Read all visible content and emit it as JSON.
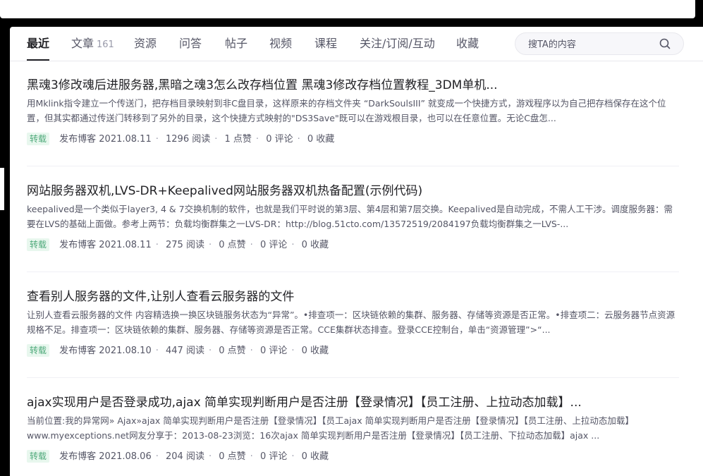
{
  "tabs": [
    {
      "label": "最近",
      "count": ""
    },
    {
      "label": "文章",
      "count": "161"
    },
    {
      "label": "资源",
      "count": ""
    },
    {
      "label": "问答",
      "count": ""
    },
    {
      "label": "帖子",
      "count": ""
    },
    {
      "label": "视频",
      "count": ""
    },
    {
      "label": "课程",
      "count": ""
    },
    {
      "label": "关注/订阅/互动",
      "count": ""
    },
    {
      "label": "收藏",
      "count": ""
    }
  ],
  "search": {
    "placeholder": "搜TA的内容",
    "value": ""
  },
  "articles": [
    {
      "title": "黑魂3修改魂后进服务器,黑暗之魂3怎么改存档位置 黑魂3修改存档位置教程_3DM单机...",
      "desc": "用Mklink指令建立一个传送门，把存档目录映射到非C盘目录，这样原来的存档文件夹 “DarkSoulsIII” 就变成一个快捷方式，游戏程序以为自己把存档保存在这个位置，但其实都通过传送门转移到了另外的目录，这个快捷方式映射的\"DS3Save\"既可以在游戏根目录，也可以在任意位置。无论C盘怎...",
      "badge": "转载",
      "published": "发布博客 2021.08.11",
      "reads": "1296 阅读",
      "likes": "1 点赞",
      "comments": "0 评论",
      "favorites": "0 收藏"
    },
    {
      "title": "网站服务器双机,LVS-DR+Keepalived网站服务器双机热备配置(示例代码)",
      "desc": "keepalived是一个类似于layer3, 4 & 7交换机制的软件，也就是我们平时说的第3层、第4层和第7层交换。Keepalived是自动完成，不需人工干涉。调度服务器：需要在LVS的基础上面做。参考上两节：负载均衡群集之一LVS-DR：http://blog.51cto.com/13572519/2084197负载均衡群集之一LVS-...",
      "badge": "转载",
      "published": "发布博客 2021.08.11",
      "reads": "275 阅读",
      "likes": "0 点赞",
      "comments": "0 评论",
      "favorites": "0 收藏"
    },
    {
      "title": "查看别人服务器的文件,让别人查看云服务器的文件",
      "desc": "让别人查看云服务器的文件 内容精选换一换区块链服务状态为“异常”。•排查项一：区块链依赖的集群、服务器、存储等资源是否正常。•排查项二：云服务器节点资源规格不足。排查项一：区块链依赖的集群、服务器、存储等资源是否正常。CCE集群状态排查。登录CCE控制台，单击“资源管理”>“...",
      "badge": "转载",
      "published": "发布博客 2021.08.10",
      "reads": "447 阅读",
      "likes": "0 点赞",
      "comments": "0 评论",
      "favorites": "0 收藏"
    },
    {
      "title": "ajax实现用户是否登录成功,ajax 简单实现判断用户是否注册【登录情况】【员工注册、上拉动态加载】...",
      "desc": "当前位置:我的异常网» Ajax»ajax 简单实现判断用户是否注册【登录情况】【员工ajax 简单实现判断用户是否注册【登录情况】【员工注册、上拉动态加载】www.myexceptions.net网友分享于：2013-08-23浏览：16次ajax 简单实现判断用户是否注册【登录情况】【员工注册、下拉动态加载】ajax ...",
      "badge": "转载",
      "published": "发布博客 2021.08.06",
      "reads": "204 阅读",
      "likes": "0 点赞",
      "comments": "0 评论",
      "favorites": "0 收藏"
    }
  ],
  "colors": {
    "badge_bg": "#e8f7ee",
    "badge_text": "#4ea97a",
    "title": "#222226",
    "desc": "#555666"
  },
  "icons": {
    "search": "search-icon"
  }
}
